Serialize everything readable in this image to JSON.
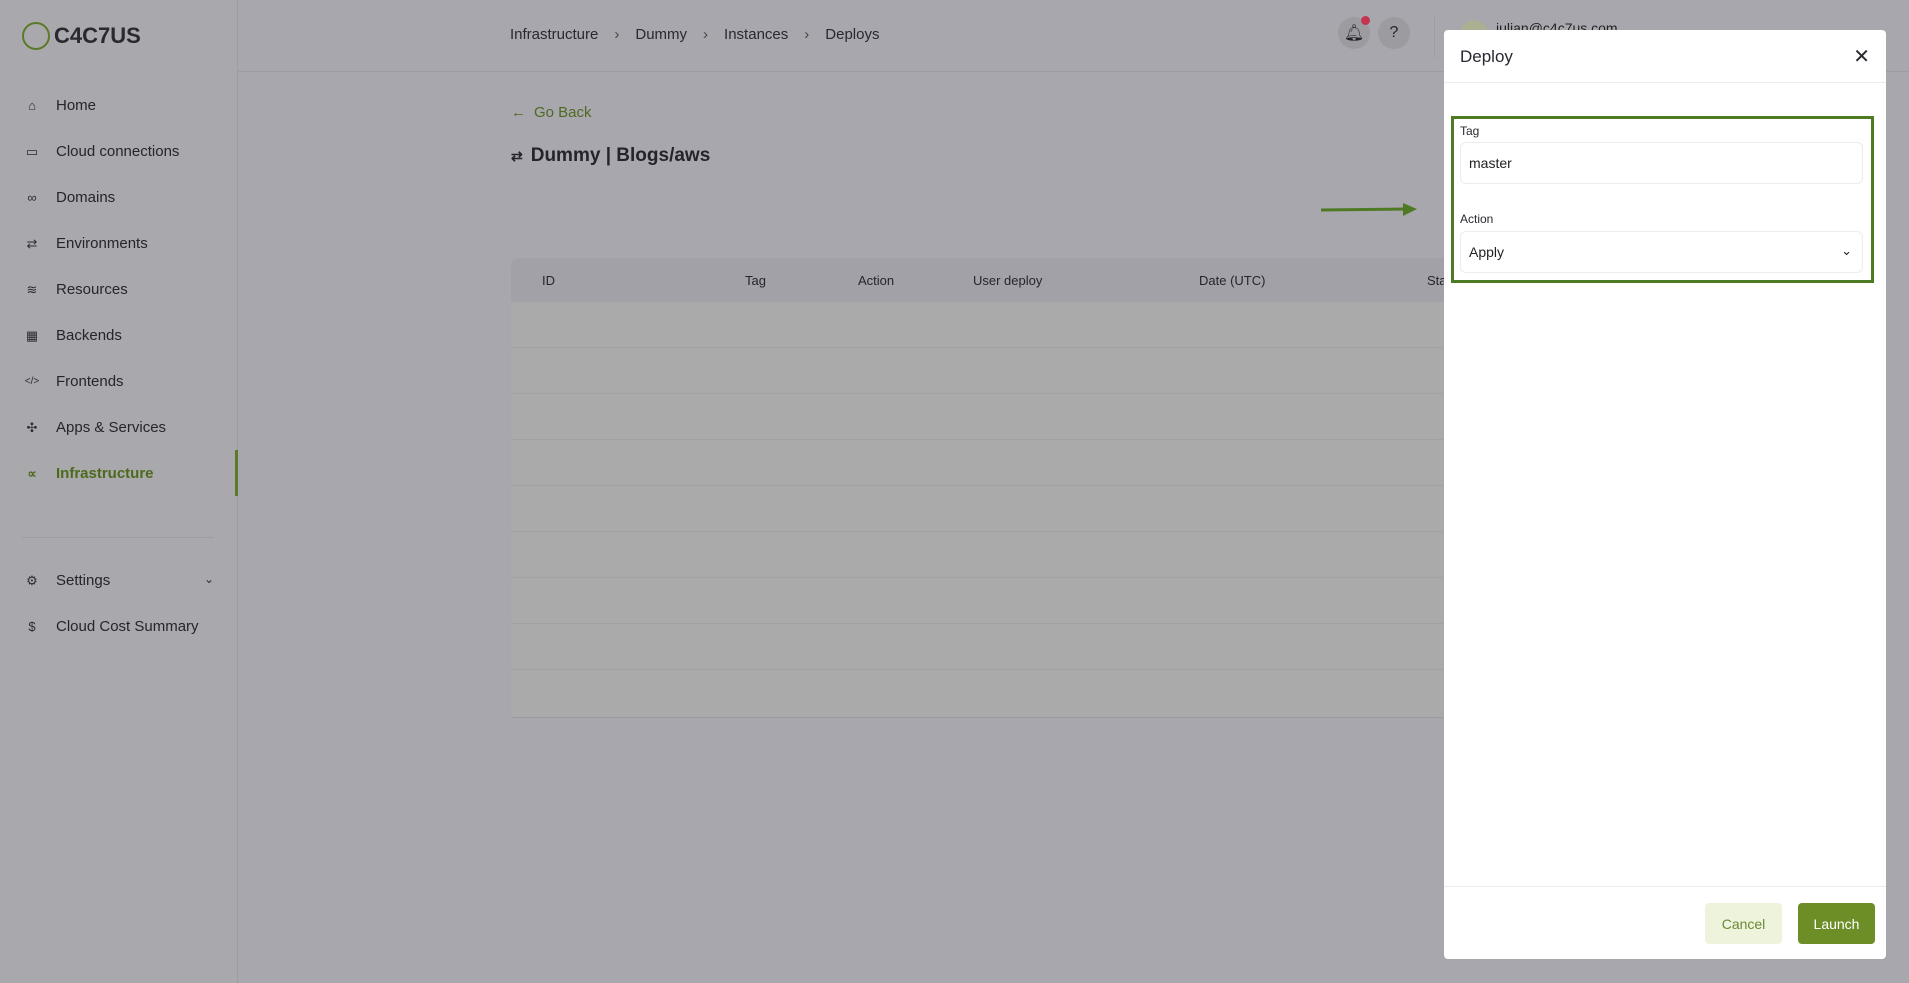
{
  "brand": {
    "name": "C4C7US",
    "accent": "#6d8e27"
  },
  "sidebar": {
    "items": [
      {
        "label": "Home",
        "icon": "home-icon",
        "glyph": "⌂"
      },
      {
        "label": "Cloud connections",
        "icon": "terminal-icon",
        "glyph": "▭"
      },
      {
        "label": "Domains",
        "icon": "link-icon",
        "glyph": "🔗"
      },
      {
        "label": "Environments",
        "icon": "swap-icon",
        "glyph": "⇄"
      },
      {
        "label": "Resources",
        "icon": "database-icon",
        "glyph": "≋"
      },
      {
        "label": "Backends",
        "icon": "grid-icon",
        "glyph": "▦"
      },
      {
        "label": "Frontends",
        "icon": "code-icon",
        "glyph": "</>"
      },
      {
        "label": "Apps & Services",
        "icon": "puzzle-icon",
        "glyph": "✣"
      },
      {
        "label": "Infrastructure",
        "icon": "share-icon",
        "glyph": "∝"
      }
    ],
    "bottom": [
      {
        "label": "Settings",
        "icon": "gear-icon",
        "glyph": "⚙"
      },
      {
        "label": "Cloud Cost Summary",
        "icon": "dollar-icon",
        "glyph": "$"
      }
    ]
  },
  "header": {
    "breadcrumb": [
      "Infrastructure",
      "Dummy",
      "Instances",
      "Deploys"
    ],
    "email": "julian@c4c7us.com"
  },
  "main": {
    "go_back": "Go Back",
    "title": "Dummy | Blogs/aws",
    "columns": [
      "ID",
      "Tag",
      "Action",
      "User deploy",
      "Date (UTC)",
      "Sta"
    ]
  },
  "modal": {
    "title": "Deploy",
    "tag_label": "Tag",
    "tag_value": "master",
    "action_label": "Action",
    "action_value": "Apply",
    "cancel": "Cancel",
    "launch": "Launch"
  }
}
